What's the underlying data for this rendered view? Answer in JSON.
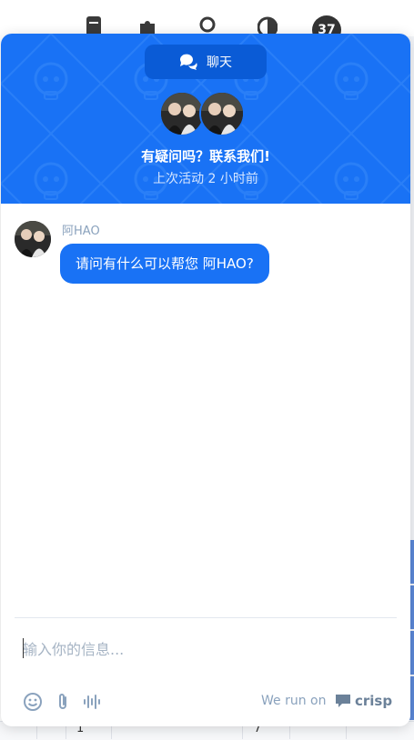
{
  "background": {
    "badge_count": "37",
    "bottom_numbers": [
      "1",
      "7"
    ]
  },
  "widget": {
    "header": {
      "tab_label": "聊天",
      "title": "有疑问吗？联系我们!",
      "status": "上次活动 2 小时前"
    },
    "message": {
      "sender": "阿HAO",
      "text": "请问有什么可以帮您 阿HAO?"
    },
    "composer": {
      "placeholder": "输入你的信息..."
    },
    "footer": {
      "powered_text": "We run on",
      "brand": "crisp"
    }
  },
  "colors": {
    "accent": "#1972f5",
    "tab_bg": "#0a5bd6",
    "muted": "#8aa2bd"
  },
  "icons": {
    "tab": "chat-bubbles-icon",
    "tools": [
      "emoji-icon",
      "attachment-icon",
      "audio-wave-icon"
    ],
    "topbar": [
      "document-icon",
      "puzzle-icon",
      "search-icon",
      "contrast-icon"
    ]
  }
}
